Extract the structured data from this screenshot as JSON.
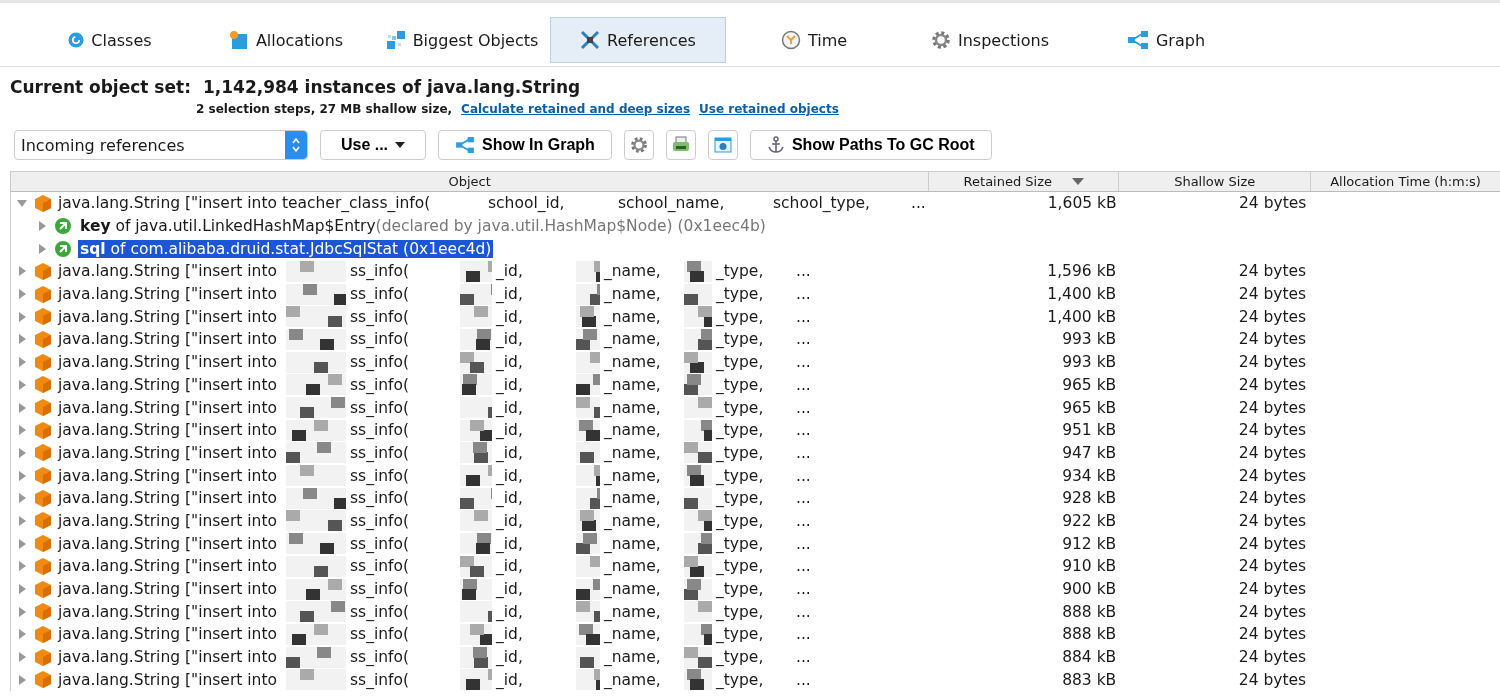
{
  "tabs": [
    {
      "label": "Classes",
      "selected": false
    },
    {
      "label": "Allocations",
      "selected": false
    },
    {
      "label": "Biggest Objects",
      "selected": false
    },
    {
      "label": "References",
      "selected": true
    },
    {
      "label": "Time",
      "selected": false
    },
    {
      "label": "Inspections",
      "selected": false
    },
    {
      "label": "Graph",
      "selected": false
    }
  ],
  "object_set": {
    "label": "Current object set:",
    "value": "1,142,984 instances of java.lang.String",
    "summary": "2 selection steps, 27 MB shallow size,",
    "links": [
      "Calculate retained and deep sizes",
      "Use retained objects"
    ]
  },
  "toolbar": {
    "reference_type": "Incoming references",
    "use_menu": "Use ...",
    "show_in_graph": "Show In Graph",
    "show_paths": "Show Paths To GC Root"
  },
  "table": {
    "columns": [
      {
        "label": "Object",
        "sorted": false
      },
      {
        "label": "Retained Size",
        "sorted": true
      },
      {
        "label": "Shallow Size",
        "sorted": false
      },
      {
        "label": "Allocation Time (h:m:s)",
        "sorted": false
      }
    ],
    "rows": [
      {
        "parts": [
          "java.lang.String [\"insert into teacher_class_info(",
          "school_id,",
          "school_name,",
          "school_type,",
          "..."
        ],
        "redacted": false,
        "retained": "1,605 kB",
        "shallow": "24 bytes",
        "expanded": true,
        "children": [
          {
            "field": "key",
            "owner": "of java.util.LinkedHashMap$Entry",
            "note": "(declared by java.util.HashMap$Node) (0x1eec4b)",
            "selected": false
          },
          {
            "field": "sql",
            "owner": "of com.alibaba.druid.stat.JdbcSqlStat (0x1eec4d)",
            "selected": true
          }
        ]
      },
      {
        "parts": [
          "java.lang.String [\"insert into",
          "ss_info(",
          "_id,",
          "_name,",
          "_type,",
          "..."
        ],
        "redacted": true,
        "retained": "1,596 kB",
        "shallow": "24 bytes",
        "expanded": false
      },
      {
        "parts": [
          "java.lang.String [\"insert into",
          "ss_info(",
          "_id,",
          "_name,",
          "_type,",
          "..."
        ],
        "redacted": true,
        "retained": "1,400 kB",
        "shallow": "24 bytes",
        "expanded": false
      },
      {
        "parts": [
          "java.lang.String [\"insert into",
          "ss_info(",
          "_id,",
          "_name,",
          "_type,",
          "..."
        ],
        "redacted": true,
        "retained": "1,400 kB",
        "shallow": "24 bytes",
        "expanded": false
      },
      {
        "parts": [
          "java.lang.String [\"insert into",
          "ss_info(",
          "_id,",
          "_name,",
          "_type,",
          "..."
        ],
        "redacted": true,
        "retained": "993 kB",
        "shallow": "24 bytes",
        "expanded": false
      },
      {
        "parts": [
          "java.lang.String [\"insert into",
          "ss_info(",
          "_id,",
          "_name,",
          "_type,",
          "..."
        ],
        "redacted": true,
        "retained": "993 kB",
        "shallow": "24 bytes",
        "expanded": false
      },
      {
        "parts": [
          "java.lang.String [\"insert into",
          "ss_info(",
          "_id,",
          "_name,",
          "_type,",
          "..."
        ],
        "redacted": true,
        "retained": "965 kB",
        "shallow": "24 bytes",
        "expanded": false
      },
      {
        "parts": [
          "java.lang.String [\"insert into",
          "ss_info(",
          "_id,",
          "_name,",
          "_type,",
          "..."
        ],
        "redacted": true,
        "retained": "965 kB",
        "shallow": "24 bytes",
        "expanded": false
      },
      {
        "parts": [
          "java.lang.String [\"insert into",
          "ss_info(",
          "_id,",
          "_name,",
          "_type,",
          "..."
        ],
        "redacted": true,
        "retained": "951 kB",
        "shallow": "24 bytes",
        "expanded": false
      },
      {
        "parts": [
          "java.lang.String [\"insert into",
          "ss_info(",
          "_id,",
          "_name,",
          "_type,",
          "..."
        ],
        "redacted": true,
        "retained": "947 kB",
        "shallow": "24 bytes",
        "expanded": false
      },
      {
        "parts": [
          "java.lang.String [\"insert into",
          "ss_info(",
          "_id,",
          "_name,",
          "_type,",
          "..."
        ],
        "redacted": true,
        "retained": "934 kB",
        "shallow": "24 bytes",
        "expanded": false
      },
      {
        "parts": [
          "java.lang.String [\"insert into",
          "ss_info(",
          "_id,",
          "_name,",
          "_type,",
          "..."
        ],
        "redacted": true,
        "retained": "928 kB",
        "shallow": "24 bytes",
        "expanded": false
      },
      {
        "parts": [
          "java.lang.String [\"insert into",
          "ss_info(",
          "_id,",
          "_name,",
          "_type,",
          "..."
        ],
        "redacted": true,
        "retained": "922 kB",
        "shallow": "24 bytes",
        "expanded": false
      },
      {
        "parts": [
          "java.lang.String [\"insert into",
          "ss_info(",
          "_id,",
          "_name,",
          "_type,",
          "..."
        ],
        "redacted": true,
        "retained": "912 kB",
        "shallow": "24 bytes",
        "expanded": false
      },
      {
        "parts": [
          "java.lang.String [\"insert into",
          "ss_info(",
          "_id,",
          "_name,",
          "_type,",
          "..."
        ],
        "redacted": true,
        "retained": "910 kB",
        "shallow": "24 bytes",
        "expanded": false
      },
      {
        "parts": [
          "java.lang.String [\"insert into",
          "ss_info(",
          "_id,",
          "_name,",
          "_type,",
          "..."
        ],
        "redacted": true,
        "retained": "900 kB",
        "shallow": "24 bytes",
        "expanded": false
      },
      {
        "parts": [
          "java.lang.String [\"insert into",
          "ss_info(",
          "_id,",
          "_name,",
          "_type,",
          "..."
        ],
        "redacted": true,
        "retained": "888 kB",
        "shallow": "24 bytes",
        "expanded": false
      },
      {
        "parts": [
          "java.lang.String [\"insert into",
          "ss_info(",
          "_id,",
          "_name,",
          "_type,",
          "..."
        ],
        "redacted": true,
        "retained": "888 kB",
        "shallow": "24 bytes",
        "expanded": false
      },
      {
        "parts": [
          "java.lang.String [\"insert into",
          "ss_info(",
          "_id,",
          "_name,",
          "_type,",
          "..."
        ],
        "redacted": true,
        "retained": "884 kB",
        "shallow": "24 bytes",
        "expanded": false
      },
      {
        "parts": [
          "java.lang.String [\"insert into",
          "ss_info(",
          "_id,",
          "_name,",
          "_type,",
          "..."
        ],
        "redacted": true,
        "retained": "883 kB",
        "shallow": "24 bytes",
        "expanded": false
      }
    ]
  }
}
